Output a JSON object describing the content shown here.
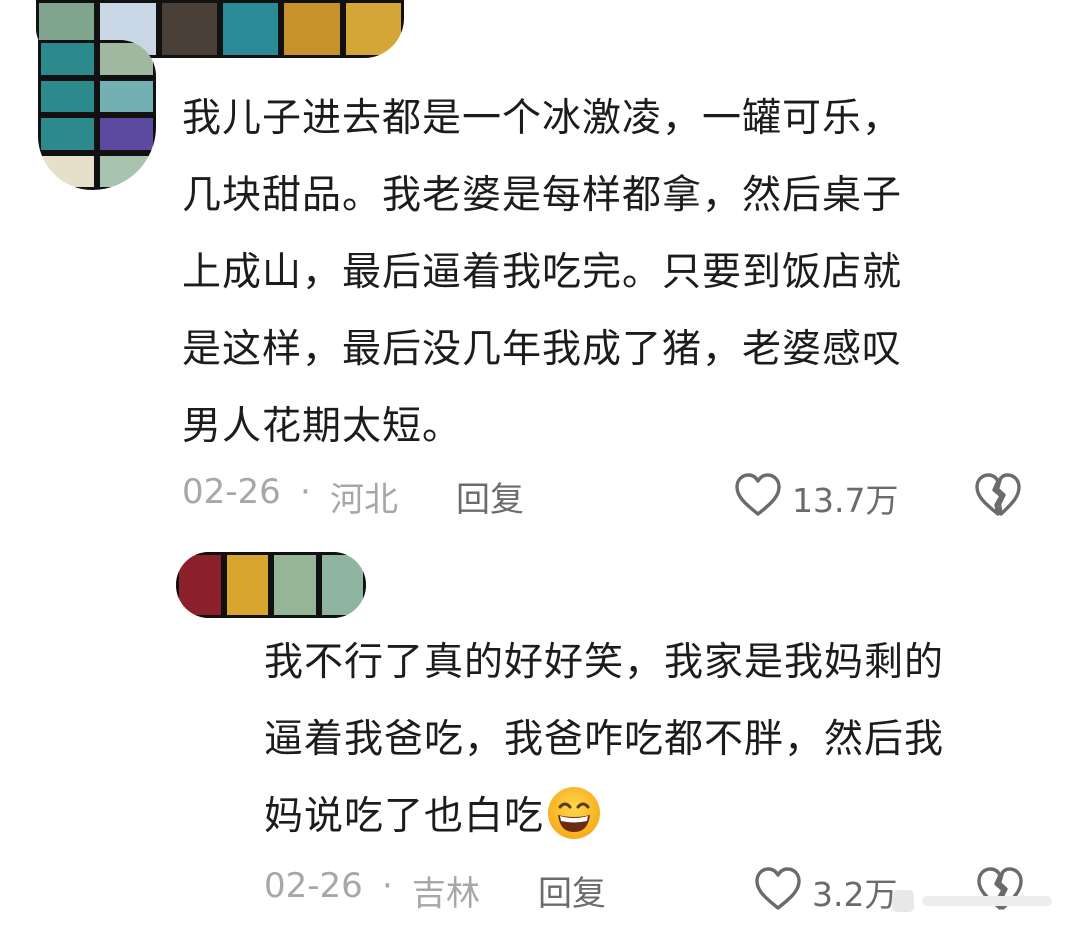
{
  "comments": [
    {
      "text": "我儿子进去都是一个冰激凌，一罐可乐，\n几块甜品。我老婆是每样都拿，然后桌子\n上成山，最后逼着我吃完。只要到饭店就\n是这样，最后没几年我成了猪，老婆感叹\n男人花期太短。",
      "date": "02-26",
      "separator": "·",
      "location": "河北",
      "reply_label": "回复",
      "like_count": "13.7万"
    },
    {
      "text": "我不行了真的好好笑，我家是我妈剩的\n逼着我爸吃，我爸咋吃都不胖，然后我\n妈说吃了也白吃",
      "date": "02-26",
      "separator": "·",
      "location": "吉林",
      "reply_label": "回复",
      "like_count": "3.2万"
    }
  ],
  "icons": {
    "like": "heart-outline-icon",
    "dislike": "broken-heart-icon",
    "emoji": "grinning-face-emoji"
  },
  "colors": {
    "text": "#1c1c1c",
    "meta": "#a7a7a7",
    "action": "#6b6b6b",
    "mosaic": [
      "#7fa58f",
      "#c9d6e6",
      "#4a4038",
      "#2a8a96",
      "#c8922a",
      "#d4a637",
      "#9fb89f",
      "#2d8a8c",
      "#73b0b3",
      "#e6dfc9",
      "#5b4aa0",
      "#a8c3b0",
      "#8b1f2a",
      "#d8a62e",
      "#94b596",
      "#8fb5a0"
    ]
  }
}
